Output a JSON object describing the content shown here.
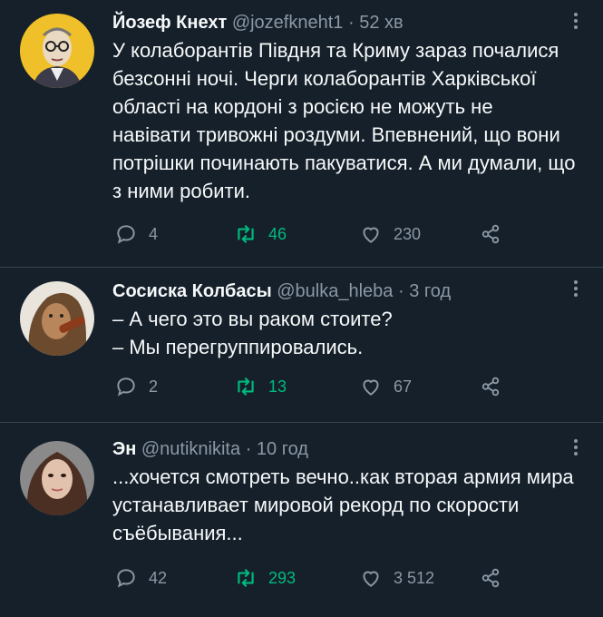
{
  "tweets": [
    {
      "name": "Йозеф Кнехт",
      "handle": "@jozefkneht1",
      "time": "52 хв",
      "text": "У колаборантів Півдня та Криму зараз почалися безсонні ночі. Черги колаборантів Харківської області на кордоні з росією не можуть не навівати тривожні роздуми. Впевнений, що вони потрішки починають пакуватися. А ми думали, що з ними робити.",
      "replies": "4",
      "retweets": "46",
      "likes": "230"
    },
    {
      "name": "Сосиска Колбасы",
      "handle": "@bulka_hleba",
      "time": "3 год",
      "text_line1": "– А чего это вы раком стоите?",
      "text_line2": "– Мы перегруппировались.",
      "replies": "2",
      "retweets": "13",
      "likes": "67"
    },
    {
      "name": "Эн",
      "handle": "@nutiknikita",
      "time": "10 год",
      "text": "...хочется смотреть вечно..как вторая армия мира устанавливает мировой рекорд по скорости съёбывания...",
      "replies": "42",
      "retweets": "293",
      "likes": "3 512"
    }
  ],
  "separator": "·",
  "colors": {
    "background": "#15202b",
    "text": "#f7f9f9",
    "muted": "#8b98a5",
    "retweet": "#00ba7c",
    "divider": "#38444d"
  },
  "icons": [
    "more-icon",
    "reply-icon",
    "retweet-icon",
    "like-icon",
    "share-icon"
  ]
}
